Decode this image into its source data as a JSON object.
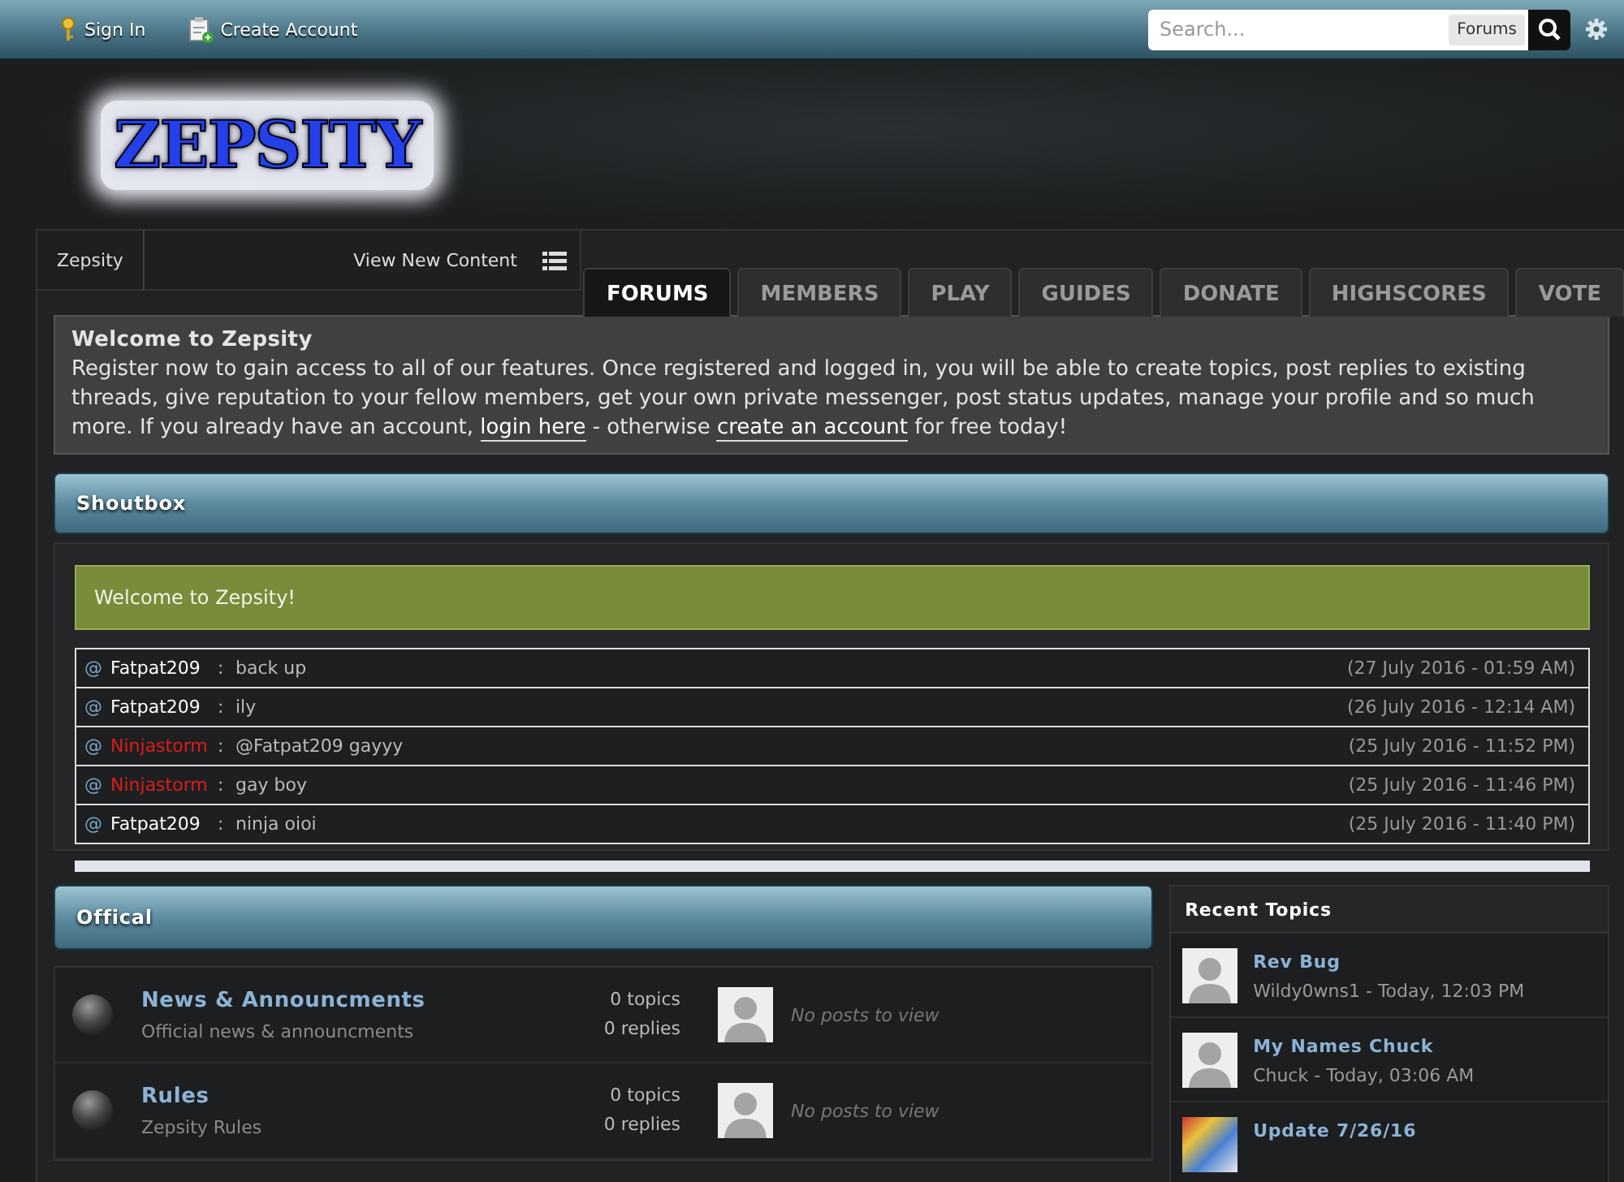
{
  "top_bar": {
    "links": [
      {
        "label": "Sign In",
        "kind": "key"
      },
      {
        "label": "Create Account",
        "kind": "clipboard"
      }
    ],
    "search": {
      "placeholder": "Search...",
      "scope": "Forums"
    }
  },
  "header": {
    "logo": "ZEPSITY"
  },
  "breadcrumb": {
    "items": [
      "Zepsity"
    ],
    "view_new": "View New Content"
  },
  "tabs": [
    {
      "label": "FORUMS",
      "selected": true
    },
    {
      "label": "MEMBERS",
      "selected": false
    },
    {
      "label": "PLAY",
      "selected": false
    },
    {
      "label": "GUIDES",
      "selected": false
    },
    {
      "label": "DONATE",
      "selected": false
    },
    {
      "label": "HIGHSCORES",
      "selected": false
    },
    {
      "label": "VOTE",
      "selected": false
    }
  ],
  "welcome": {
    "title": "Welcome to Zepsity",
    "body": [
      {
        "kind": "text",
        "text": "Register now to gain access to all of our features. Once registered and logged in, you will be able to create topics, post replies to existing threads, give reputation to your fellow members, get your own private messenger, post status updates, manage your profile and so much more. If you already have an account, "
      },
      {
        "kind": "link",
        "text": "login here"
      },
      {
        "kind": "text",
        "text": " - otherwise "
      },
      {
        "kind": "link",
        "text": "create an account"
      },
      {
        "kind": "text",
        "text": " for free today!"
      }
    ]
  },
  "shoutbox": {
    "title": "Shoutbox",
    "notice": "Welcome to Zepsity!",
    "messages": [
      {
        "prefix": "@",
        "user": "Fatpat209",
        "color": "#ffffff",
        "separator": ":",
        "text": "back up",
        "time": "(27 July 2016 - 01:59 AM)"
      },
      {
        "prefix": "@",
        "user": "Fatpat209",
        "color": "#ffffff",
        "separator": ":",
        "text": "ily",
        "time": "(26 July 2016 - 12:14 AM)"
      },
      {
        "prefix": "@",
        "user": "Ninjastorm",
        "color": "#dd1c1c",
        "separator": ":",
        "text": "@Fatpat209 gayyy",
        "time": "(25 July 2016 - 11:52 PM)"
      },
      {
        "prefix": "@",
        "user": "Ninjastorm",
        "color": "#dd1c1c",
        "separator": ":",
        "text": "gay boy",
        "time": "(25 July 2016 - 11:46 PM)"
      },
      {
        "prefix": "@",
        "user": "Fatpat209",
        "color": "#ffffff",
        "separator": ":",
        "text": "ninja oioi",
        "time": "(25 July 2016 - 11:40 PM)"
      }
    ]
  },
  "category": {
    "title": "Offical",
    "forums": [
      {
        "title": "News & Announcments",
        "description": "Official news & announcments",
        "topics": "0 topics",
        "replies": "0 replies",
        "last_post": "No posts to view"
      },
      {
        "title": "Rules",
        "description": "Zepsity Rules",
        "topics": "0 topics",
        "replies": "0 replies",
        "last_post": "No posts to view"
      }
    ]
  },
  "recent_topics": {
    "title": "Recent Topics",
    "items": [
      {
        "title": "Rev Bug",
        "meta": "Wildy0wns1 - Today, 12:03 PM",
        "kind": "avatar"
      },
      {
        "title": "My Names Chuck",
        "meta": "Chuck - Today, 03:06 AM",
        "kind": "avatar"
      },
      {
        "title": "Update 7/26/16",
        "kind": "image"
      }
    ]
  }
}
